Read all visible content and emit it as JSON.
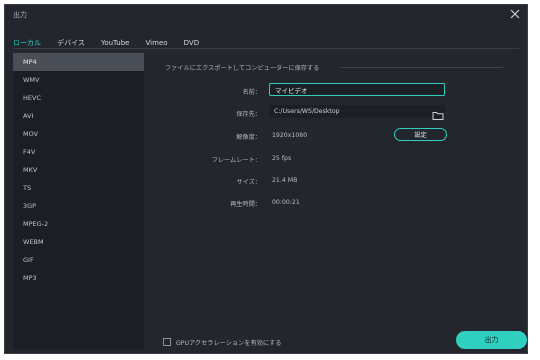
{
  "window": {
    "title": "出力"
  },
  "tabs": [
    {
      "label": "ローカル",
      "active": true
    },
    {
      "label": "デバイス"
    },
    {
      "label": "YouTube"
    },
    {
      "label": "Vimeo"
    },
    {
      "label": "DVD"
    }
  ],
  "formats": [
    "MP4",
    "WMV",
    "HEVC",
    "AVI",
    "MOV",
    "F4V",
    "MKV",
    "TS",
    "3GP",
    "MPEG-2",
    "WEBM",
    "GIF",
    "MP3"
  ],
  "selected_format": "MP4",
  "settings": {
    "section_title": "ファイルにエクスポートしてコンピューターに保存する",
    "name_label": "名前：",
    "name_value": "マイビデオ",
    "save_label": "保存先：",
    "save_path": "C:/Users/WS/Desktop",
    "resolution_label": "解像度：",
    "resolution_value": "1920x1080",
    "settings_button": "設定",
    "framerate_label": "フレームレート：",
    "framerate_value": "25 fps",
    "size_label": "サイズ：",
    "size_value": "21.4 MB",
    "duration_label": "再生時間：",
    "duration_value": "00:00:21"
  },
  "gpu_label": "GPUアクセラレーションを有効にする",
  "export_button": "出力",
  "colors": {
    "accent": "#2fd0c0",
    "background": "#23272d",
    "list_background": "#1b1e23",
    "selected": "#4a4f57"
  },
  "icons": {
    "close": "close-icon",
    "folder": "folder-icon",
    "checkbox": "checkbox-icon"
  }
}
